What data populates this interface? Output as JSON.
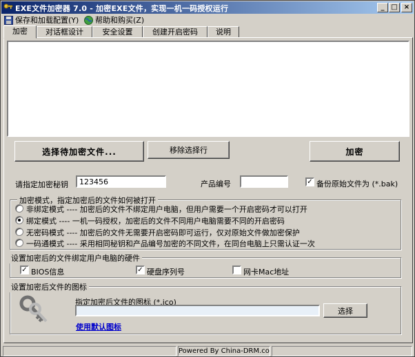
{
  "window": {
    "title": "EXE文件加密器 7.0 - 加密EXE文件，实现一机一码授权运行",
    "controls": {
      "minimize": "_",
      "maximize": "□",
      "close": "×"
    }
  },
  "menu": {
    "items": [
      {
        "label": "保存和加载配置(Y)",
        "icon": "save-icon"
      },
      {
        "label": "帮助和购买(Z)",
        "icon": "globe-icon"
      }
    ]
  },
  "tabs": [
    {
      "label": "加密",
      "active": true
    },
    {
      "label": "对话框设计",
      "active": false
    },
    {
      "label": "安全设置",
      "active": false
    },
    {
      "label": "创建开启密码",
      "active": false
    },
    {
      "label": "说明",
      "active": false
    }
  ],
  "buttons": {
    "select_file": "选择待加密文件...",
    "remove_selected": "移除选择行",
    "encrypt": "加密"
  },
  "fields": {
    "key_label": "请指定加密秘钥",
    "key_value": "123456",
    "product_label": "产品编号",
    "product_value": "",
    "backup_label": "备份原始文件为 (*.bak)",
    "backup_checked": true
  },
  "mode_group": {
    "title": "加密模式，指定加密后的文件如何被打开",
    "options": [
      {
        "label": "非绑定模式 ---- 加密后的文件不绑定用户电脑，但用户需要一个开启密码才可以打开",
        "checked": false
      },
      {
        "label": "绑定模式 ---- 一机一码授权，加密后的文件不同用户电脑需要不同的开启密码",
        "checked": true
      },
      {
        "label": "无密码模式 ---- 加密后的文件无需要开启密码即可运行，仅对原始文件做加密保护",
        "checked": false
      },
      {
        "label": "一码通模式 ---- 采用相同秘钥和产品编号加密的不同文件，在同台电脑上只需认证一次",
        "checked": false
      }
    ]
  },
  "hardware_group": {
    "title": "设置加密后的文件绑定用户电脑的硬件",
    "options": [
      {
        "label": "BIOS信息",
        "checked": true
      },
      {
        "label": "硬盘序列号",
        "checked": true
      },
      {
        "label": "网卡Mac地址",
        "checked": false
      }
    ]
  },
  "icon_group": {
    "title": "设置加密后文件的图标",
    "field_label": "指定加密后文件的图标 (*.ico)",
    "field_value": "",
    "browse_button": "选择",
    "default_link": "使用默认图标"
  },
  "statusbar": {
    "panels": [
      "",
      "Powered By China-DRM.com",
      ""
    ]
  },
  "colors": {
    "face": "#d4d0c8",
    "title_start": "#0a246a",
    "title_end": "#a6caf0",
    "link": "#0000cc"
  }
}
